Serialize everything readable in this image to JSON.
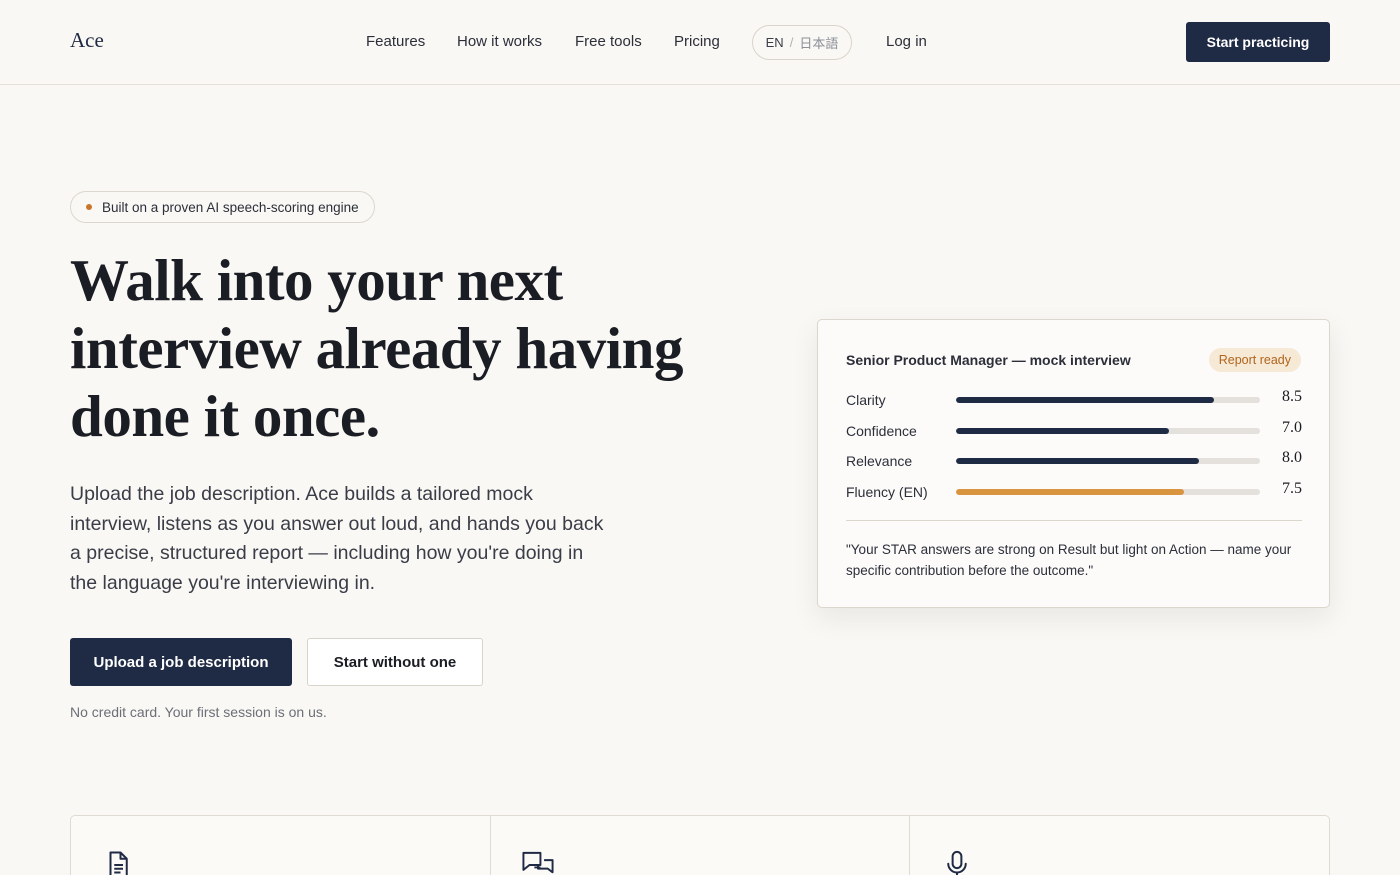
{
  "header": {
    "logo": "Ace",
    "nav": [
      {
        "label": "Features"
      },
      {
        "label": "How it works"
      },
      {
        "label": "Free tools"
      },
      {
        "label": "Pricing"
      }
    ],
    "lang": {
      "en": "EN",
      "sep": "/",
      "ja": "日本語"
    },
    "login": "Log in",
    "cta": "Start practicing"
  },
  "hero": {
    "pill": "Built on a proven AI speech-scoring engine",
    "headline": "Walk into your next interview already having done it once.",
    "subtext": "Upload the job description. Ace builds a tailored mock interview, listens as you answer out loud, and hands you back a precise, structured report — including how you're doing in the language you're interviewing in.",
    "primary_button": "Upload a job description",
    "secondary_button": "Start without one",
    "note": "No credit card. Your first session is on us."
  },
  "report": {
    "title": "Senior Product Manager — mock interview",
    "badge": "Report ready",
    "max_score": 10,
    "metrics": [
      {
        "label": "Clarity",
        "score": "8.5",
        "value": 8.5
      },
      {
        "label": "Confidence",
        "score": "7.0",
        "value": 7.0
      },
      {
        "label": "Relevance",
        "score": "8.0",
        "value": 8.0
      },
      {
        "label": "Fluency (EN)",
        "score": "7.5",
        "value": 7.5
      }
    ],
    "quote": "\"Your STAR answers are strong on Result but light on Action — name your specific contribution before the outcome.\""
  },
  "features": [
    {
      "icon": "document-icon"
    },
    {
      "icon": "chat-bubbles-icon"
    },
    {
      "icon": "microphone-icon"
    }
  ],
  "colors": {
    "brand": "#1f2a44",
    "accent": "#d99440",
    "background": "#faf8f4"
  }
}
